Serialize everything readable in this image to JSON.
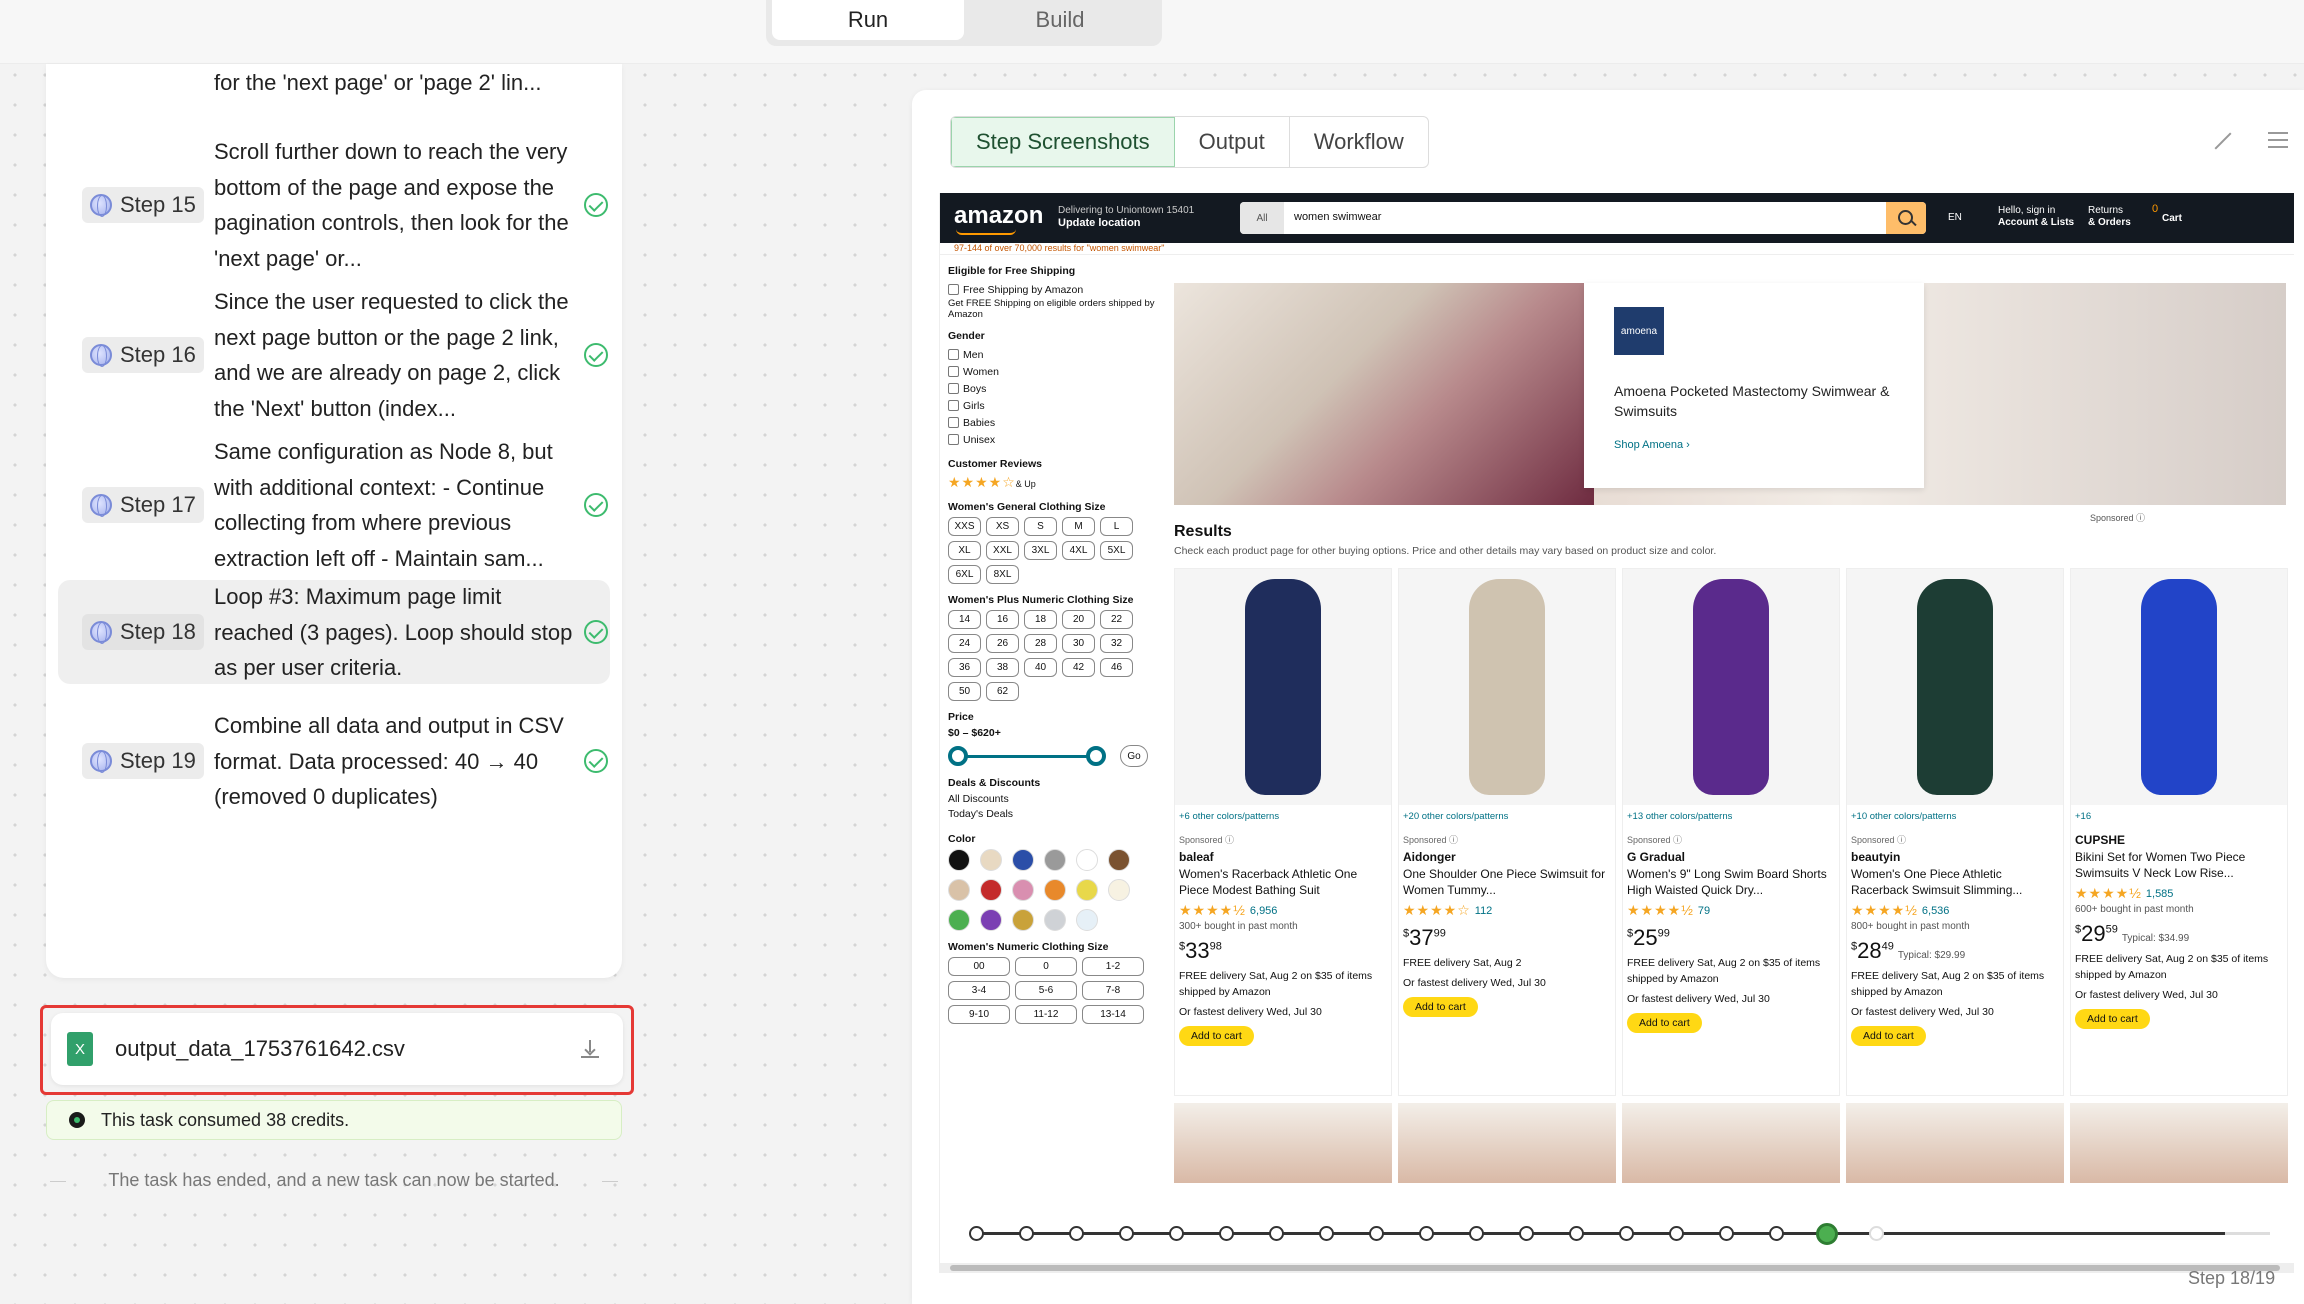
{
  "mode_tabs": {
    "run": "Run",
    "build": "Build"
  },
  "steps": {
    "prev_tail": "for the 'next page' or 'page 2' lin...",
    "items": [
      {
        "label": "Step 15",
        "text": "Scroll further down to reach the very bottom of the page and expose the pagination controls, then look for the 'next page' or..."
      },
      {
        "label": "Step 16",
        "text": "Since the user requested to click the next page button or the page 2 link, and we are already on page 2, click the 'Next' button (index..."
      },
      {
        "label": "Step 17",
        "text": "Same configuration as Node 8, but with additional context: - Continue collecting from where previous extraction left off - Maintain sam..."
      },
      {
        "label": "Step 18",
        "text": "Loop #3: Maximum page limit reached (3 pages). Loop should stop as per user criteria."
      },
      {
        "label": "Step 19",
        "text": "Combine all data and output in CSV format. Data processed: 40 → 40 (removed 0 duplicates)"
      }
    ]
  },
  "output_file": {
    "icon": "X",
    "name": "output_data_1753761642.csv"
  },
  "credits_text": "This task consumed 38 credits.",
  "ended_text": "The task has ended, and a new task can now be started.",
  "view_tabs": {
    "screenshots": "Step Screenshots",
    "output": "Output",
    "workflow": "Workflow"
  },
  "amazon": {
    "logo": "amazon",
    "deliver_line1": "Delivering to Uniontown 15401",
    "deliver_line2": "Update location",
    "search_scope": "All",
    "search_query": "women swimwear",
    "lang": "EN",
    "account_line1": "Hello, sign in",
    "account_line2": "Account & Lists",
    "returns_line1": "Returns",
    "returns_line2": "& Orders",
    "cart_label": "Cart",
    "cart_count": "0",
    "result_count": "97-144 of over 70,000 results for \"women swimwear\"",
    "filters": {
      "shipping_title": "Eligible for Free Shipping",
      "shipping_opt": "Free Shipping by Amazon",
      "shipping_note": "Get FREE Shipping on eligible orders shipped by Amazon",
      "gender_title": "Gender",
      "genders": [
        "Men",
        "Women",
        "Boys",
        "Girls",
        "Babies",
        "Unisex"
      ],
      "reviews_title": "Customer Reviews",
      "reviews_up": "& Up",
      "general_size_title": "Women's General Clothing Size",
      "general_sizes": [
        "XXS",
        "XS",
        "S",
        "M",
        "L",
        "XL",
        "XXL",
        "3XL",
        "4XL",
        "5XL",
        "6XL",
        "8XL"
      ],
      "plus_size_title": "Women's Plus Numeric Clothing Size",
      "plus_sizes": [
        "14",
        "16",
        "18",
        "20",
        "22",
        "24",
        "26",
        "28",
        "30",
        "32",
        "36",
        "38",
        "40",
        "42",
        "46",
        "50",
        "62"
      ],
      "price_title": "Price",
      "price_range": "$0 – $620+",
      "go": "Go",
      "deals_title": "Deals & Discounts",
      "deals": [
        "All Discounts",
        "Today's Deals"
      ],
      "color_title": "Color",
      "colors": [
        "#111111",
        "#e8d9c2",
        "#2b4ea8",
        "#9a9a9a",
        "#ffffff",
        "#7a5230",
        "#d9c2a8",
        "#c42b2b",
        "#d98fb0",
        "#e8892b",
        "#e8d84a",
        "#f7f2e2",
        "#4caf50",
        "#7b3fb3",
        "#c9a23a",
        "#cfd2d6",
        "#e6f0f7"
      ],
      "numeric_title": "Women's Numeric Clothing Size",
      "numeric_sizes": [
        "00",
        "0",
        "1-2",
        "3-4",
        "5-6",
        "7-8",
        "9-10",
        "11-12",
        "13-14"
      ]
    },
    "banner": {
      "logo": "amoena",
      "title": "Amoena Pocketed Mastectomy Swimwear & Swimsuits",
      "link": "Shop Amoena ›",
      "sponsored": "Sponsored ⓘ"
    },
    "results_title": "Results",
    "results_sub": "Check each product page for other buying options. Price and other details may vary based on product size and color.",
    "products": [
      {
        "colors": "+6 other colors/patterns",
        "sponsored": "Sponsored ⓘ",
        "brand": "baleaf",
        "title": "Women's Racerback Athletic One Piece Modest Bathing Suit",
        "stars": "★★★★½",
        "count": "6,956",
        "bought": "300+ bought in past month",
        "price_whole": "33",
        "price_frac": "98",
        "typical": "",
        "delivery": "FREE delivery Sat, Aug 2 on $35 of items shipped by Amazon",
        "fastest": "Or fastest delivery Wed, Jul 30",
        "cart": "Add to cart",
        "fig_color": "#1f2d5c"
      },
      {
        "colors": "+20 other colors/patterns",
        "sponsored": "Sponsored ⓘ",
        "brand": "Aidonger",
        "title": "One Shoulder One Piece Swimsuit for Women Tummy...",
        "stars": "★★★★☆",
        "count": "112",
        "bought": "",
        "price_whole": "37",
        "price_frac": "99",
        "typical": "",
        "delivery": "FREE delivery Sat, Aug 2",
        "fastest": "Or fastest delivery Wed, Jul 30",
        "cart": "Add to cart",
        "fig_color": "#cfc3b0"
      },
      {
        "colors": "+13 other colors/patterns",
        "sponsored": "Sponsored ⓘ",
        "brand": "G Gradual",
        "title": "Women's 9\" Long Swim Board Shorts High Waisted Quick Dry...",
        "stars": "★★★★½",
        "count": "79",
        "bought": "",
        "price_whole": "25",
        "price_frac": "99",
        "typical": "",
        "delivery": "FREE delivery Sat, Aug 2 on $35 of items shipped by Amazon",
        "fastest": "Or fastest delivery Wed, Jul 30",
        "cart": "Add to cart",
        "fig_color": "#5a2a8c"
      },
      {
        "colors": "+10 other colors/patterns",
        "sponsored": "Sponsored ⓘ",
        "brand": "beautyin",
        "title": "Women's One Piece Athletic Racerback Swimsuit Slimming...",
        "stars": "★★★★½",
        "count": "6,536",
        "bought": "800+ bought in past month",
        "price_whole": "28",
        "price_frac": "49",
        "typical": "Typical: $29.99",
        "delivery": "FREE delivery Sat, Aug 2 on $35 of items shipped by Amazon",
        "fastest": "Or fastest delivery Wed, Jul 30",
        "cart": "Add to cart",
        "fig_color": "#1d3d34"
      },
      {
        "colors": "+16",
        "sponsored": "",
        "brand": "CUPSHE",
        "title": "Bikini Set for Women Two Piece Swimsuits V Neck Low Rise...",
        "stars": "★★★★½",
        "count": "1,585",
        "bought": "600+ bought in past month",
        "price_whole": "29",
        "price_frac": "59",
        "typical": "Typical: $34.99",
        "delivery": "FREE delivery Sat, Aug 2 on $35 of items shipped by Amazon",
        "fastest": "Or fastest delivery Wed, Jul 30",
        "cart": "Add to cart",
        "fig_color": "#2244c8"
      }
    ]
  },
  "timeline": {
    "total": 19,
    "current": 18,
    "label": "Step 18/19"
  }
}
